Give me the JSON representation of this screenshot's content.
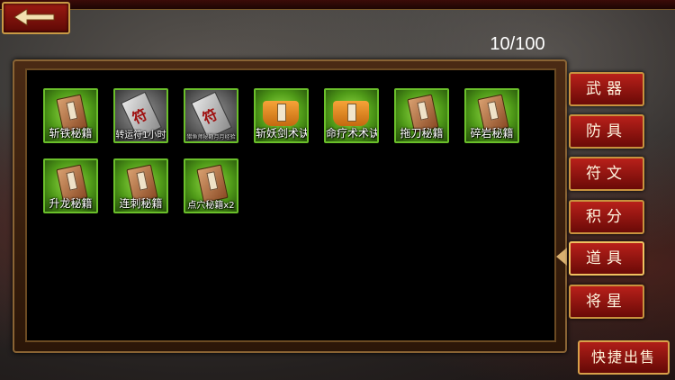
{
  "header": {
    "back_icon": "back-arrow-icon",
    "capacity": "10/100"
  },
  "inventory": {
    "items": [
      {
        "label": "斩铁秘籍",
        "icon": "book-icon"
      },
      {
        "label": "转运符1小时",
        "icon": "talisman-icon"
      },
      {
        "label": "猎鱼师秘籍月月经验",
        "icon": "talisman-icon"
      },
      {
        "label": "斩妖剑术诀",
        "icon": "scroll-icon"
      },
      {
        "label": "命疗术术诀",
        "icon": "scroll-icon"
      },
      {
        "label": "拖刀秘籍",
        "icon": "book-icon"
      },
      {
        "label": "碎岩秘籍",
        "icon": "book-icon"
      },
      {
        "label": "升龙秘籍",
        "icon": "book-icon"
      },
      {
        "label": "连刺秘籍",
        "icon": "book-icon"
      },
      {
        "label": "点穴秘籍x2",
        "icon": "book-icon"
      }
    ]
  },
  "tabs": [
    {
      "label": "武器"
    },
    {
      "label": "防具"
    },
    {
      "label": "符文"
    },
    {
      "label": "积分"
    },
    {
      "label": "道具",
      "active": true
    },
    {
      "label": "将星"
    }
  ],
  "sell_button": {
    "label": "快捷出售"
  },
  "colors": {
    "tab_red": "#b8201a",
    "frame_gold": "#c8923e",
    "item_green": "#6abf2a"
  }
}
